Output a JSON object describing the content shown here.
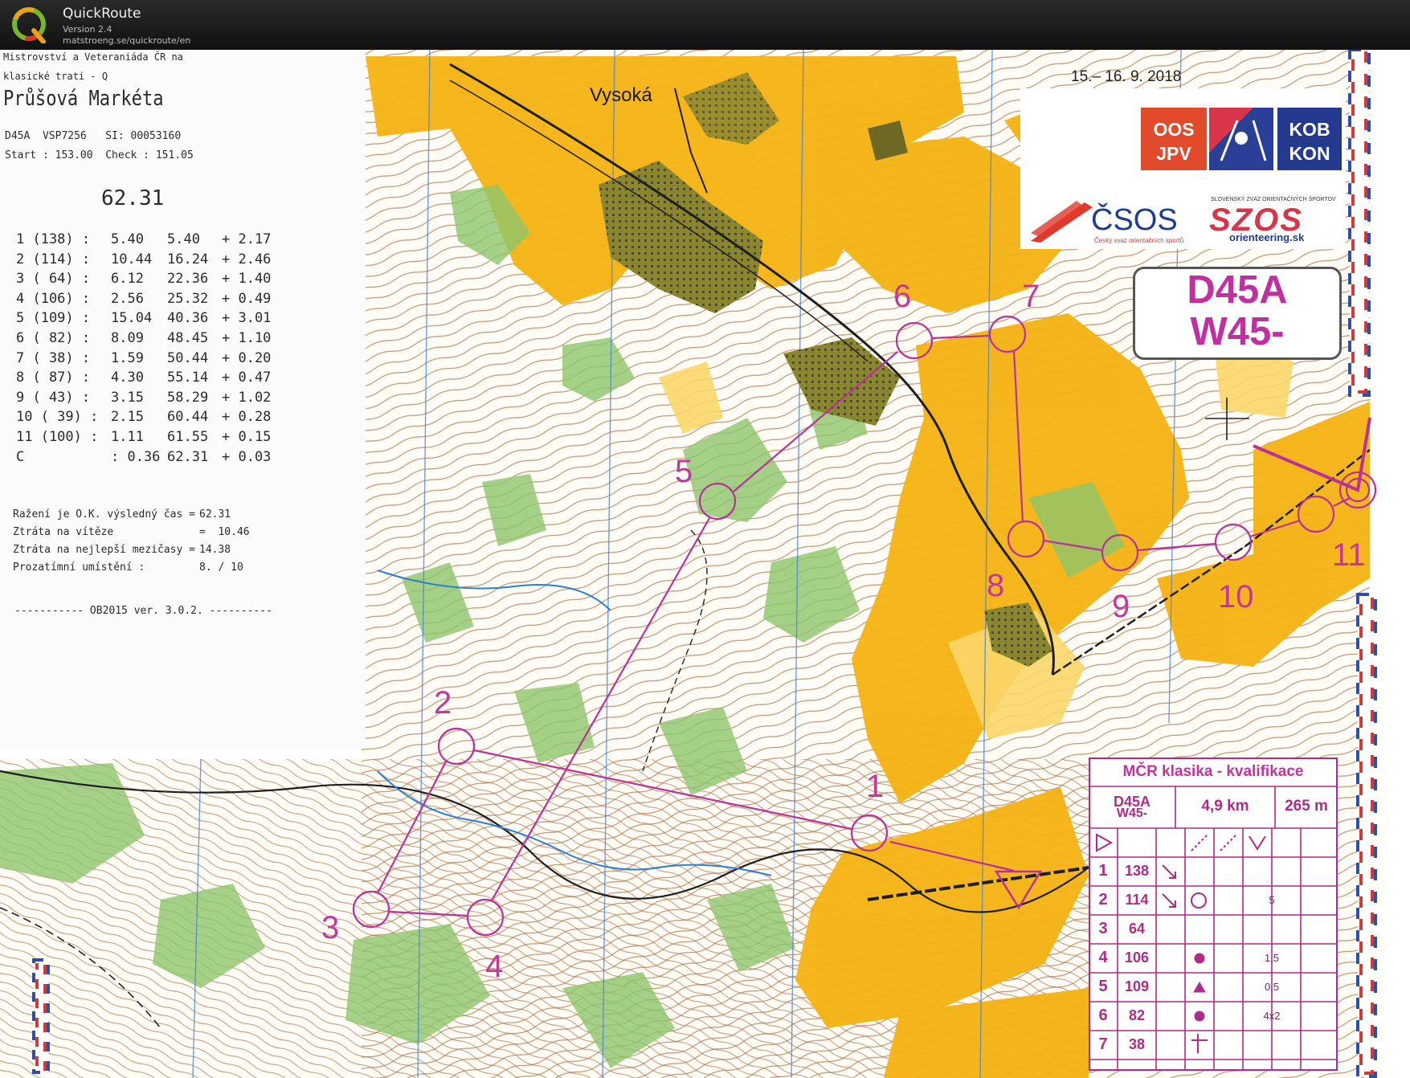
{
  "app": {
    "name": "QuickRoute",
    "version": "Version 2.4",
    "url": "matstroeng.se/quickroute/en",
    "logo_icon": "quickroute-logo-icon"
  },
  "splits": {
    "event_line_1": "Mistrovství a Veteraniáda ČR na",
    "event_line_2": "klasické trati - Q",
    "runner_name": "Průšová Markéta",
    "runner_info": "D45A  VSP7256   SI: 00053160",
    "start_check": "Start : 153.00  Check : 151.05",
    "total_time": "62.31",
    "rows": [
      {
        "leg": "1 (138) :",
        "split": "5.40",
        "cumulative": "5.40",
        "loss": "+ 2.17"
      },
      {
        "leg": "2 (114) :",
        "split": "10.44",
        "cumulative": "16.24",
        "loss": "+ 2.46"
      },
      {
        "leg": "3 ( 64) :",
        "split": "6.12",
        "cumulative": "22.36",
        "loss": "+ 1.40"
      },
      {
        "leg": "4 (106) :",
        "split": "2.56",
        "cumulative": "25.32",
        "loss": "+ 0.49"
      },
      {
        "leg": "5 (109) :",
        "split": "15.04",
        "cumulative": "40.36",
        "loss": "+ 3.01"
      },
      {
        "leg": "6 ( 82) :",
        "split": "8.09",
        "cumulative": "48.45",
        "loss": "+ 1.10"
      },
      {
        "leg": "7 ( 38) :",
        "split": "1.59",
        "cumulative": "50.44",
        "loss": "+ 0.20"
      },
      {
        "leg": "8 ( 87) :",
        "split": "4.30",
        "cumulative": "55.14",
        "loss": "+ 0.47"
      },
      {
        "leg": "9 ( 43) :",
        "split": "3.15",
        "cumulative": "58.29",
        "loss": "+ 1.02"
      },
      {
        "leg": "10 ( 39) :",
        "split": "2.15",
        "cumulative": "60.44",
        "loss": "+ 0.28"
      },
      {
        "leg": "11 (100) :",
        "split": "1.11",
        "cumulative": "61.55",
        "loss": "+ 0.15"
      },
      {
        "leg": "C",
        "split": ": 0.36",
        "cumulative": "62.31",
        "loss": "+ 0.03"
      }
    ],
    "summary": [
      {
        "label": "Ražení je O.K. výsledný čas =",
        "value": "62.31"
      },
      {
        "label": "Ztráta na vítěze",
        "value": "=  10.46"
      },
      {
        "label": "Ztráta na nejlepší mezičasy =",
        "value": "14.38"
      },
      {
        "label": "Prozatímní umístění :",
        "value": "8. / 10"
      }
    ],
    "footer": "----------- OB2015 ver. 3.0.2. ----------"
  },
  "map": {
    "place_name": "Vysoká",
    "date": "15.– 16. 9. 2018",
    "course_badge": {
      "line1": "D45A",
      "line2": "W45-"
    },
    "logos": {
      "oos": "OOS",
      "jpv": "JPV",
      "kob": "KOB",
      "kon": "KON",
      "csos": "ČSOS",
      "csos_sub": "Český svaz orientačních sportů",
      "szos": "SZOS",
      "szos_top": "SLOVENSKÝ ZVÄZ ORIENTAČNÝCH ŠPORTOV",
      "szos_sub": "orienteering.sk"
    },
    "control_labels": [
      "1",
      "2",
      "3",
      "4",
      "5",
      "6",
      "7",
      "8",
      "9",
      "10",
      "11"
    ],
    "colors": {
      "course": "#b8329a",
      "open_land": "#f5b312",
      "forest_green": "#8dc66b",
      "urban": "#7d7a2c",
      "contour": "#b0744a"
    }
  },
  "description_sheet": {
    "title": "MČR klasika - kvalifikace",
    "class_line1": "D45A",
    "class_line2": "W45-",
    "length": "4,9 km",
    "climb": "265 m",
    "rows": [
      {
        "num": "1",
        "code": "138",
        "extra": ""
      },
      {
        "num": "2",
        "code": "114",
        "extra": "5"
      },
      {
        "num": "3",
        "code": "64",
        "extra": ""
      },
      {
        "num": "4",
        "code": "106",
        "extra": "1,5"
      },
      {
        "num": "5",
        "code": "109",
        "extra": "0,5"
      },
      {
        "num": "6",
        "code": "82",
        "extra": "4x2"
      },
      {
        "num": "7",
        "code": "38",
        "extra": ""
      }
    ]
  }
}
